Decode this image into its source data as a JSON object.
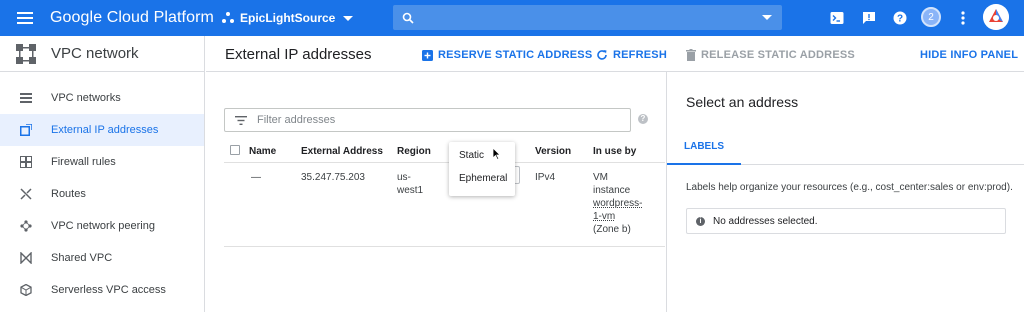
{
  "app": {
    "brand": "Google Cloud Platform",
    "project": "EpicLightSource",
    "notification_count": "2"
  },
  "sidebar": {
    "title": "VPC network",
    "items": [
      {
        "label": "VPC networks",
        "icon": "vpc-networks-icon"
      },
      {
        "label": "External IP addresses",
        "icon": "external-ip-icon",
        "active": true
      },
      {
        "label": "Firewall rules",
        "icon": "firewall-icon"
      },
      {
        "label": "Routes",
        "icon": "routes-icon"
      },
      {
        "label": "VPC network peering",
        "icon": "peering-icon"
      },
      {
        "label": "Shared VPC",
        "icon": "shared-vpc-icon"
      },
      {
        "label": "Serverless VPC access",
        "icon": "serverless-icon"
      }
    ]
  },
  "main": {
    "title": "External IP addresses",
    "actions": {
      "reserve": "RESERVE STATIC ADDRESS",
      "refresh": "REFRESH",
      "release": "RELEASE STATIC ADDRESS",
      "hide_info": "HIDE INFO PANEL"
    },
    "filter_placeholder": "Filter addresses",
    "help": "?",
    "columns": {
      "name": "Name",
      "address": "External Address",
      "region": "Region",
      "version": "Version",
      "in_use_by": "In use by"
    },
    "rows": [
      {
        "name": "—",
        "address": "35.247.75.203",
        "region_1": "us-",
        "region_2": "west1",
        "version": "IPv4",
        "in_use_1": "VM",
        "in_use_2": "instance",
        "in_use_3": "wordpress-",
        "in_use_4": "1-vm",
        "in_use_5": "(Zone b)"
      }
    ],
    "type_dropdown": [
      "Static",
      "Ephemeral"
    ]
  },
  "info_panel": {
    "title": "Select an address",
    "tab": "LABELS",
    "description": "Labels help organize your resources (e.g., cost_center:sales or env:prod).",
    "empty_message": "No addresses selected.",
    "info_glyph": "i"
  },
  "colors": {
    "primary": "#1a73e8",
    "active_bg": "#e8f0fe",
    "disabled": "#9aa0a6"
  }
}
